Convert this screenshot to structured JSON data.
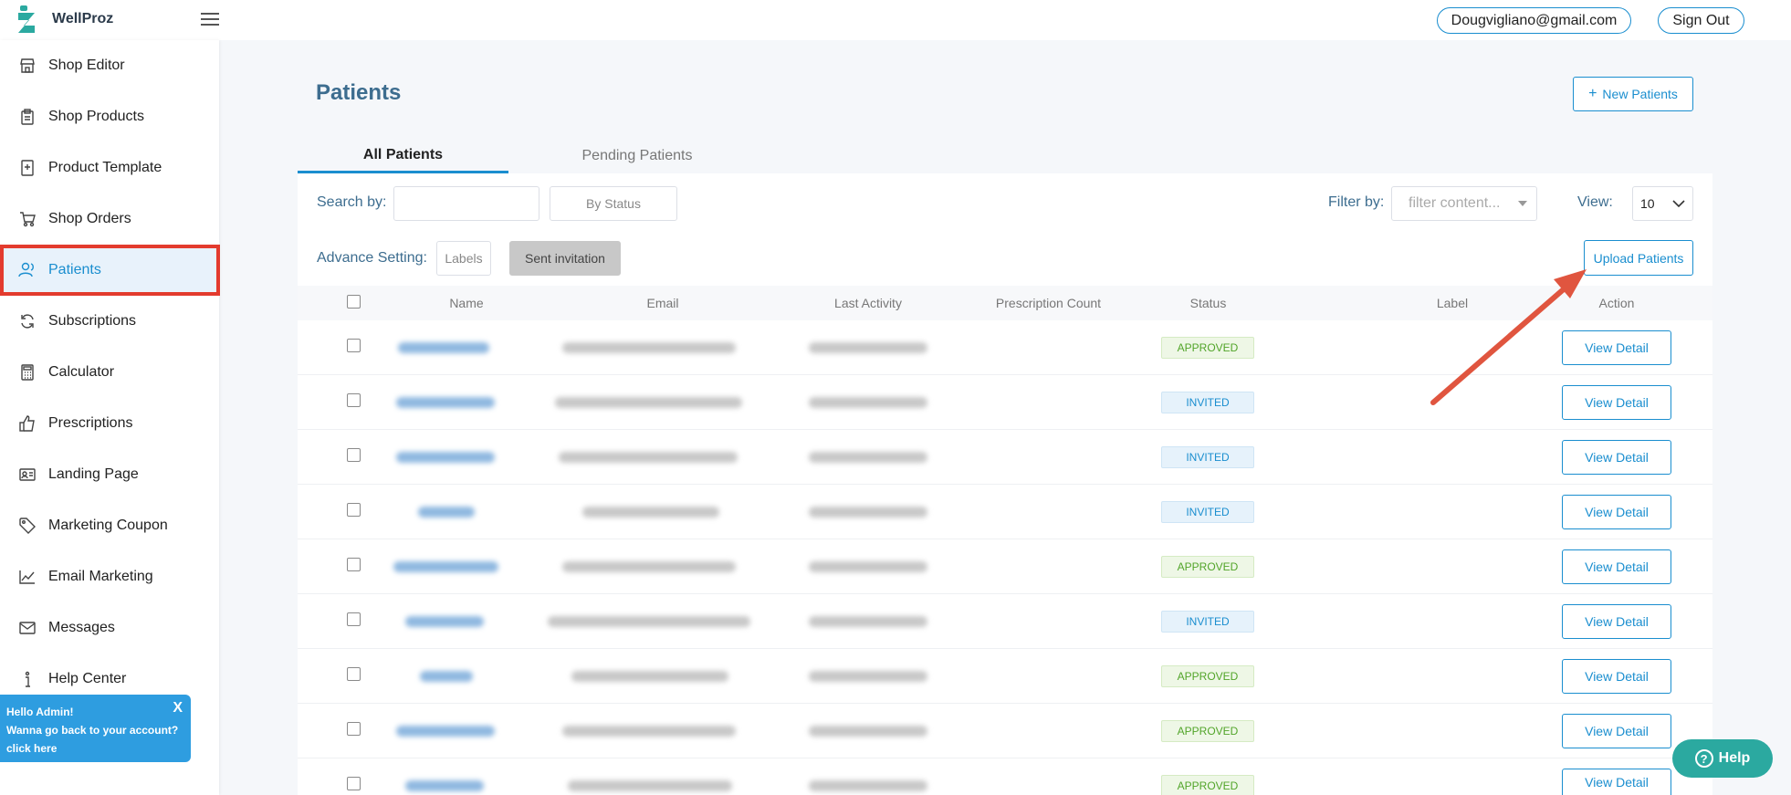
{
  "app": {
    "brand": "WellProz"
  },
  "header": {
    "account_email": "Dougvigliano@gmail.com",
    "sign_out": "Sign Out"
  },
  "sidebar": {
    "items": [
      {
        "label": "Shop Editor",
        "icon": "store-icon"
      },
      {
        "label": "Shop Products",
        "icon": "clipboard-icon"
      },
      {
        "label": "Product Template",
        "icon": "template-icon"
      },
      {
        "label": "Shop Orders",
        "icon": "cart-icon"
      },
      {
        "label": "Patients",
        "icon": "users-icon",
        "active": true
      },
      {
        "label": "Subscriptions",
        "icon": "refresh-icon"
      },
      {
        "label": "Calculator",
        "icon": "calculator-icon"
      },
      {
        "label": "Prescriptions",
        "icon": "thumbs-up-icon"
      },
      {
        "label": "Landing Page",
        "icon": "id-card-icon"
      },
      {
        "label": "Marketing Coupon",
        "icon": "tag-icon"
      },
      {
        "label": "Email Marketing",
        "icon": "chart-icon"
      },
      {
        "label": "Messages",
        "icon": "mail-icon"
      },
      {
        "label": "Help Center",
        "icon": "info-icon"
      }
    ]
  },
  "admin_popup": {
    "line1": "Hello Admin!",
    "line2": "Wanna go back to your account?",
    "line3": "click here",
    "close": "X"
  },
  "main": {
    "title": "Patients",
    "new_button": "New Patients",
    "new_button_icon": "+",
    "tabs": [
      "All Patients",
      "Pending Patients"
    ],
    "search_label": "Search by:",
    "search_value": "",
    "by_status": "By Status",
    "filter_label": "Filter by:",
    "filter_placeholder": "filter content...",
    "view_label": "View:",
    "view_value": "10",
    "advance_label": "Advance Setting:",
    "labels_btn": "Labels",
    "sent_invitation_btn": "Sent invitation",
    "upload_btn": "Upload Patients"
  },
  "table": {
    "columns": [
      "Name",
      "Email",
      "Last Activity",
      "Prescription Count",
      "Status",
      "Label",
      "Action"
    ],
    "action_label": "View Detail",
    "rows": [
      {
        "status": "APPROVED"
      },
      {
        "status": "INVITED"
      },
      {
        "status": "INVITED"
      },
      {
        "status": "INVITED"
      },
      {
        "status": "APPROVED"
      },
      {
        "status": "INVITED"
      },
      {
        "status": "APPROVED"
      },
      {
        "status": "APPROVED"
      },
      {
        "status": "APPROVED"
      }
    ]
  },
  "help": {
    "label": "Help",
    "icon": "?"
  },
  "colors": {
    "accent": "#1a8ecf",
    "highlight": "#e33b2e",
    "title": "#3d6d8f",
    "help": "#2ba9a0"
  }
}
